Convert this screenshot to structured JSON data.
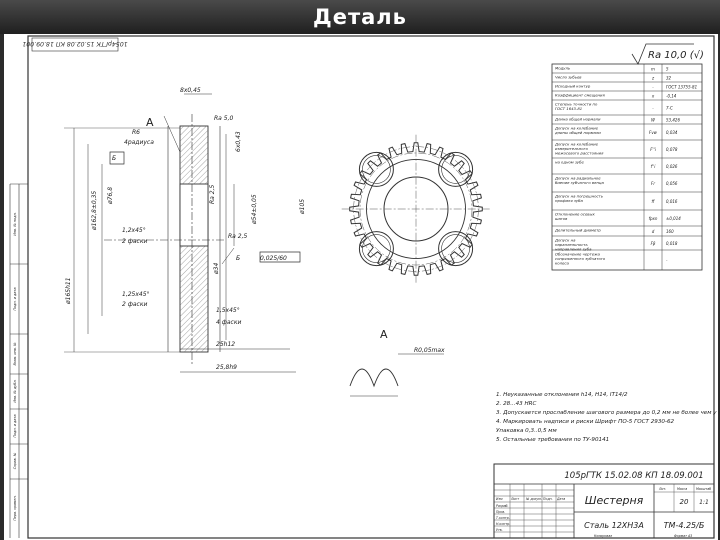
{
  "header": {
    "title": "Деталь"
  },
  "drawing": {
    "rotated_stamp": "1054рГТК 15.02.08 КП 18.09.001",
    "roughness_main": "Ra 10,0 (√)",
    "section_label": "A",
    "detail_label": "A",
    "dimensions": {
      "d1": "8x0,45",
      "d2": "6x0,43",
      "d3": "R6",
      "d4": "4радиуса",
      "d5": "Ra 5,0",
      "d6": "Б",
      "d7": "Ra 2,5",
      "d8": "1,2x45°",
      "d9": "2 фаски",
      "d10": "Ra 2,5",
      "d11": "0,025/60",
      "d12": "Б",
      "d13": "ø34",
      "d14": "ø165h11",
      "d15": "ø105",
      "d16": "ø54±0,05",
      "d17": "ø76,8",
      "d18": "1,25x45°",
      "d19": "2 фаски",
      "d20": "1,5x45°",
      "d21": "4 фаски",
      "d22": "25h12",
      "d23": "25,8h9",
      "d24": "R0,05max",
      "d25": "ø162,8±0,35"
    },
    "params": [
      [
        "Модуль",
        "m",
        "5"
      ],
      [
        "Число зубьев",
        "z",
        "32"
      ],
      [
        "Исходный контур",
        "-",
        "ГОСТ 13755-81"
      ],
      [
        "Коэффициент смещения",
        "x",
        "-0,14"
      ],
      [
        "Степень точности по ГОСТ 1643-81",
        "-",
        "7-С"
      ],
      [
        "Длина общей нормали",
        "W",
        "53,426"
      ],
      [
        "Допуск на колебание длины общей нормали",
        "Fvw",
        "0,034"
      ],
      [
        "Допуск на колебание измерительного межосевого расстояния за оборот колеса",
        "F''i",
        "0,078"
      ],
      [
        "на одном зубе",
        "f''i",
        "0,026"
      ],
      [
        "Допуск на радиальное биение зубчатого венца",
        "Fr",
        "0,056"
      ],
      [
        "Допуск на погрешность профиля зуба",
        "ff",
        "0,016"
      ],
      [
        "Отклонение осевых шагов",
        "fpxn",
        "±0,014"
      ],
      [
        "Делительный диаметр",
        "d",
        "160"
      ],
      [
        "Допуск на параллельность направления зуба",
        "Fβ",
        "0,018"
      ],
      [
        "Обозначение чертежа сопряженного зубчатого колеса",
        "",
        "-"
      ]
    ],
    "notes": [
      "1. Неуказанные отклонения h14, H14, IT14/2",
      "2. 28...43 HRC",
      "3. Допускается прослабление шагового размера до 0,2 мм не более чем у 6-ти зубьев",
      "4. Маркировать надписи и риски Шрифт ПО-5 ГОСТ 2930-62",
      "   Упаковка 0,3..0,5 мм",
      "5. Остальные требования по ТУ-90141"
    ],
    "titleblock": {
      "code": "105рГТК 15.02.08 КП 18.09.001",
      "name": "Шестерня",
      "material": "Сталь 12ХН3А",
      "group": "ТМ-4.25/Б",
      "mass": "20",
      "scale": "1:1",
      "lit_label": "Лит.",
      "mass_label": "Масса",
      "scale_label": "Масштаб",
      "sheet_label": "Лист",
      "sheets_label": "Листов",
      "col_labels": [
        "Изм",
        "Лист",
        "№ докум.",
        "Подп.",
        "Дата"
      ],
      "roles": [
        "Разраб.",
        "Пров.",
        "Т.контр.",
        "Н.контр.",
        "Утв."
      ],
      "footer": [
        "Копировал",
        "Формат А3"
      ]
    },
    "side_labels": [
      "Инв. № подл.",
      "Подп. и дата",
      "Взам. инв. №",
      "Инв. № дубл.",
      "Подп. и дата",
      "Справ. №",
      "Перв. примен."
    ]
  }
}
